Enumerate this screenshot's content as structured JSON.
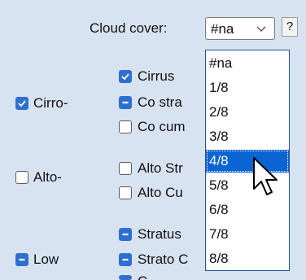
{
  "cloud_cover": {
    "label": "Cloud cover:",
    "selected": "#na",
    "help_label": "?",
    "options": [
      "#na",
      "1/8",
      "2/8",
      "3/8",
      "4/8",
      "5/8",
      "6/8",
      "7/8",
      "8/8"
    ],
    "highlighted": "4/8"
  },
  "groups": {
    "cirro": {
      "label": "Cirro-",
      "state": "checked"
    },
    "alto": {
      "label": "Alto-",
      "state": "unchecked"
    },
    "low": {
      "label": "Low",
      "state": "mixed"
    }
  },
  "types": {
    "cirrus": {
      "label": "Cirrus",
      "state": "checked"
    },
    "cirrostratus": {
      "label": "Co stra",
      "state": "mixed"
    },
    "cirrocumulus": {
      "label": "Co cum",
      "state": "unchecked"
    },
    "altostratus": {
      "label": "Alto Str",
      "state": "unchecked"
    },
    "altocumulus": {
      "label": "Alto Cu",
      "state": "unchecked"
    },
    "stratus": {
      "label": "Stratus",
      "state": "mixed"
    },
    "stratocumulus": {
      "label": "Strato C",
      "state": "mixed"
    },
    "partial_bottom": {
      "label": "C",
      "state": "mixed"
    }
  },
  "colors": {
    "background": "#d8e3f2",
    "checkbox_blue": "#2f6fd0",
    "selection_blue": "#0b64d4"
  }
}
